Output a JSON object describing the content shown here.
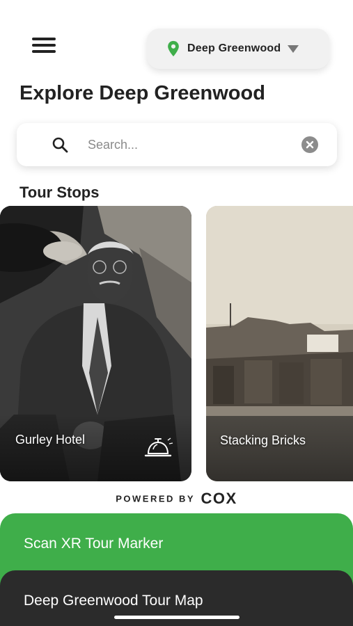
{
  "header": {
    "menu_icon": "hamburger-menu-icon",
    "location_icon": "map-pin-icon",
    "location_name": "Deep Greenwood",
    "dropdown_icon": "caret-down-icon",
    "accent_color": "#3fae4a"
  },
  "page_title": "Explore Deep Greenwood",
  "search": {
    "placeholder": "Search...",
    "value": "",
    "search_icon": "search-icon",
    "clear_icon": "clear-circle-icon"
  },
  "tour_stops": {
    "title": "Tour Stops",
    "cards": [
      {
        "label": "Gurley Hotel",
        "icon": "service-bell-icon"
      },
      {
        "label": "Stacking Bricks",
        "icon": ""
      }
    ]
  },
  "footer": {
    "powered_by": "POWERED BY",
    "brand": "COX"
  },
  "actions": {
    "scan_label": "Scan XR Tour Marker",
    "scan_color": "#3fae4a",
    "map_label": "Deep Greenwood Tour Map",
    "map_color": "#2b2b2b"
  }
}
